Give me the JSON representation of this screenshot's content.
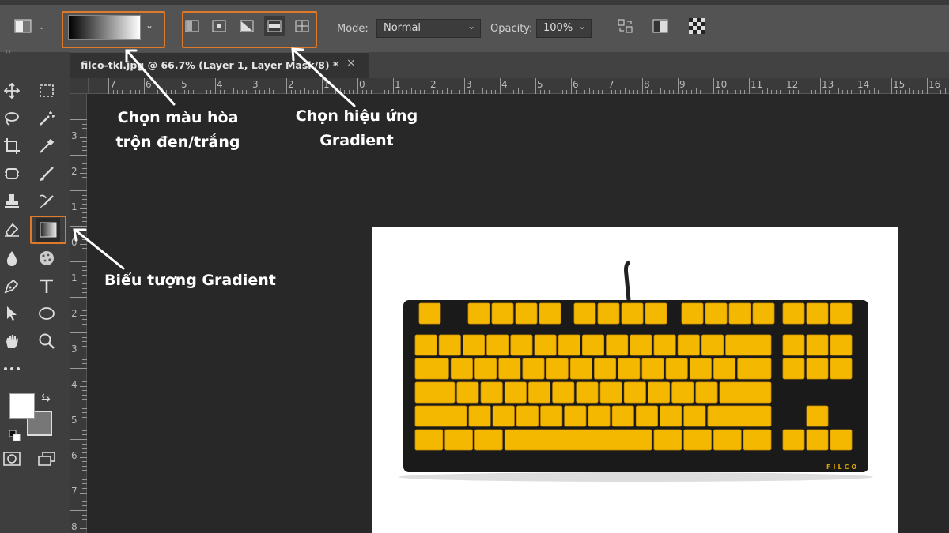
{
  "options_bar": {
    "mode_label": "Mode:",
    "mode_value": "Normal",
    "opacity_label": "Opacity:",
    "opacity_value": "100%"
  },
  "document_tab": {
    "title": "filco-tkl.jpg @ 66.7% (Layer 1, Layer Mask/8) *",
    "close_glyph": "×"
  },
  "rulers": {
    "horizontal_labels": [
      "8",
      "7",
      "6",
      "5",
      "4",
      "3",
      "2",
      "1",
      "0",
      "1",
      "2",
      "3",
      "4",
      "5",
      "6",
      "7",
      "8",
      "9",
      "10",
      "11",
      "12",
      "13",
      "14",
      "15",
      "16"
    ],
    "vertical_labels": [
      "3",
      "2",
      "1",
      "0",
      "1",
      "2",
      "3",
      "4",
      "5",
      "6",
      "7",
      "8"
    ]
  },
  "annotations": {
    "gradient_color": [
      "Chọn màu hòa",
      "trộn đen/trắng"
    ],
    "gradient_effect": [
      "Chọn hiệu ứng",
      "Gradient"
    ],
    "gradient_icon": "Biểu tượng Gradient"
  },
  "keyboard_brand": "FILCO",
  "colors": {
    "highlight": "#e07a2b",
    "keycap": "#f4b800",
    "keyboard_case": "#1a1a1a"
  },
  "icons": [
    "move",
    "marquee",
    "lasso",
    "magic-wand",
    "crop",
    "eyedropper",
    "patch",
    "brush",
    "stamp",
    "history-brush",
    "eraser",
    "gradient",
    "blur",
    "sponge",
    "pen",
    "type",
    "path-select",
    "ellipse",
    "hand",
    "zoom",
    "more",
    "color-swap",
    "quick-mask",
    "screen-mode"
  ]
}
